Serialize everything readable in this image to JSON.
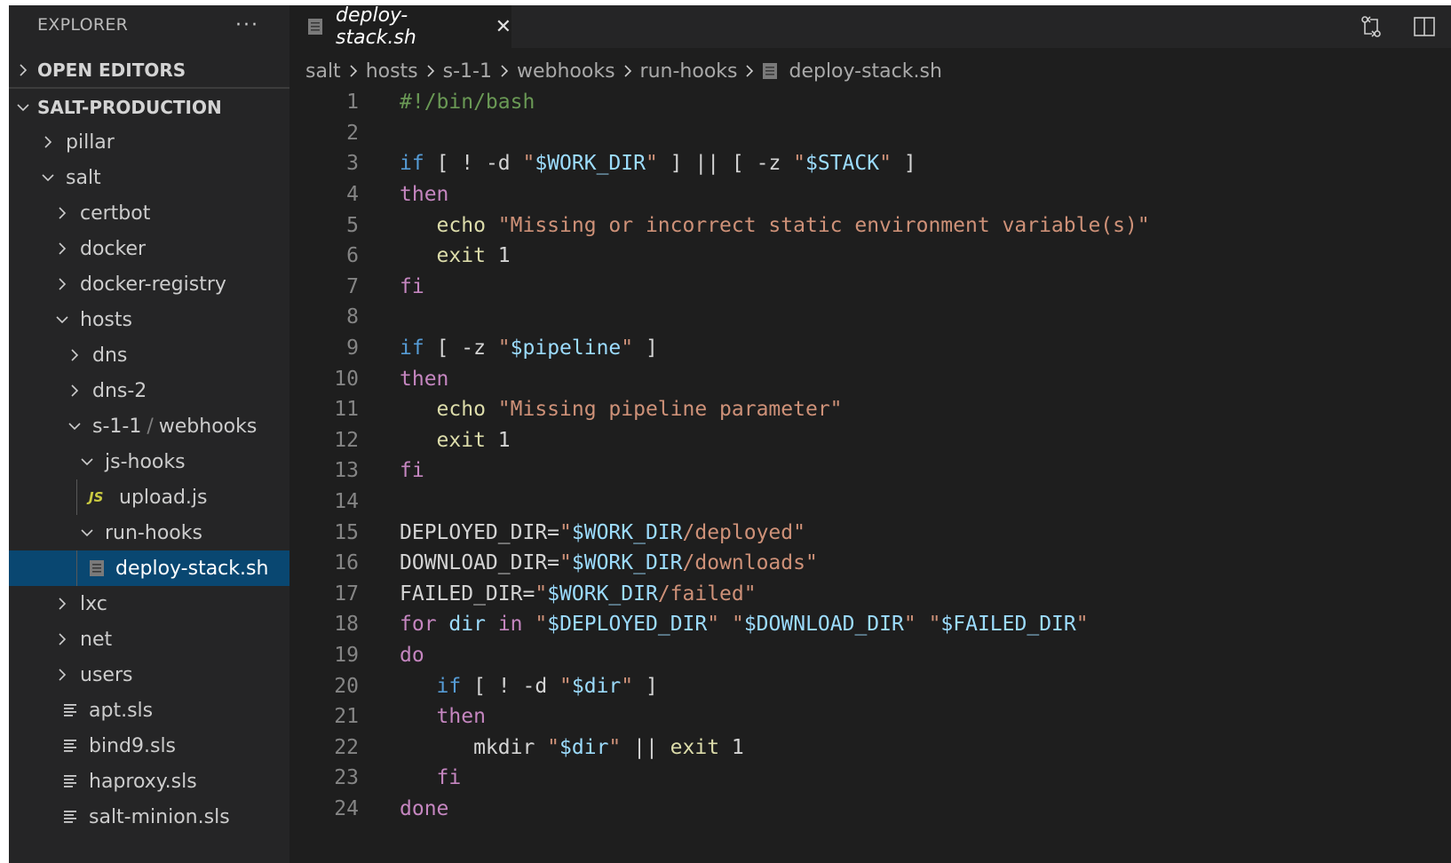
{
  "sidebar": {
    "title": "EXPLORER",
    "more_label": "···",
    "open_editors": "OPEN EDITORS",
    "workspace": "SALT-PRODUCTION",
    "tree": [
      {
        "label": "pillar",
        "level": 0,
        "kind": "folder",
        "expanded": false
      },
      {
        "label": "salt",
        "level": 0,
        "kind": "folder",
        "expanded": true
      },
      {
        "label": "certbot",
        "level": 1,
        "kind": "folder",
        "expanded": false
      },
      {
        "label": "docker",
        "level": 1,
        "kind": "folder",
        "expanded": false
      },
      {
        "label": "docker-registry",
        "level": 1,
        "kind": "folder",
        "expanded": false
      },
      {
        "label": "hosts",
        "level": 1,
        "kind": "folder",
        "expanded": true
      },
      {
        "label": "dns",
        "level": 2,
        "kind": "folder",
        "expanded": false
      },
      {
        "label": "dns-2",
        "level": 2,
        "kind": "folder",
        "expanded": false
      },
      {
        "label": "s-1-1",
        "suffix": "webhooks",
        "separator": "/",
        "level": 2,
        "kind": "folder",
        "expanded": true
      },
      {
        "label": "js-hooks",
        "level": 3,
        "kind": "folder",
        "expanded": true
      },
      {
        "label": "upload.js",
        "level": 4,
        "kind": "js",
        "icon_text": "JS"
      },
      {
        "label": "run-hooks",
        "level": 3,
        "kind": "folder",
        "expanded": true
      },
      {
        "label": "deploy-stack.sh",
        "level": 4,
        "kind": "sh",
        "selected": true
      },
      {
        "label": "lxc",
        "level": 1,
        "kind": "folder",
        "expanded": false
      },
      {
        "label": "net",
        "level": 1,
        "kind": "folder",
        "expanded": false
      },
      {
        "label": "users",
        "level": 1,
        "kind": "folder",
        "expanded": false
      },
      {
        "label": "apt.sls",
        "level": 1,
        "kind": "sls"
      },
      {
        "label": "bind9.sls",
        "level": 1,
        "kind": "sls"
      },
      {
        "label": "haproxy.sls",
        "level": 1,
        "kind": "sls"
      },
      {
        "label": "salt-minion.sls",
        "level": 1,
        "kind": "sls"
      }
    ]
  },
  "editor": {
    "tab": {
      "label": "deploy-stack.sh",
      "close": "✕"
    },
    "breadcrumb": [
      "salt",
      "hosts",
      "s-1-1",
      "webhooks",
      "run-hooks",
      "deploy-stack.sh"
    ],
    "lines": [
      [
        [
          "#!/bin/bash",
          "comment"
        ]
      ],
      [],
      [
        [
          "if",
          "kw"
        ],
        [
          " [ ! -d ",
          "plain"
        ],
        [
          "\"",
          "str"
        ],
        [
          "$WORK_DIR",
          "var"
        ],
        [
          "\"",
          "str"
        ],
        [
          " ] || [ -z ",
          "plain"
        ],
        [
          "\"",
          "str"
        ],
        [
          "$STACK",
          "var"
        ],
        [
          "\"",
          "str"
        ],
        [
          " ]",
          "plain"
        ]
      ],
      [
        [
          "then",
          "ctrl"
        ]
      ],
      [
        [
          "   ",
          "plain"
        ],
        [
          "echo",
          "builtin"
        ],
        [
          " ",
          "plain"
        ],
        [
          "\"Missing or incorrect static environment variable(s)\"",
          "str"
        ]
      ],
      [
        [
          "   ",
          "plain"
        ],
        [
          "exit",
          "builtin"
        ],
        [
          " 1",
          "plain"
        ]
      ],
      [
        [
          "fi",
          "ctrl"
        ]
      ],
      [],
      [
        [
          "if",
          "kw"
        ],
        [
          " [ -z ",
          "plain"
        ],
        [
          "\"",
          "str"
        ],
        [
          "$pipeline",
          "var"
        ],
        [
          "\"",
          "str"
        ],
        [
          " ]",
          "plain"
        ]
      ],
      [
        [
          "then",
          "ctrl"
        ]
      ],
      [
        [
          "   ",
          "plain"
        ],
        [
          "echo",
          "builtin"
        ],
        [
          " ",
          "plain"
        ],
        [
          "\"Missing pipeline parameter\"",
          "str"
        ]
      ],
      [
        [
          "   ",
          "plain"
        ],
        [
          "exit",
          "builtin"
        ],
        [
          " 1",
          "plain"
        ]
      ],
      [
        [
          "fi",
          "ctrl"
        ]
      ],
      [],
      [
        [
          "DEPLOYED_DIR=",
          "plain"
        ],
        [
          "\"",
          "str"
        ],
        [
          "$WORK_DIR",
          "var"
        ],
        [
          "/deployed\"",
          "str"
        ]
      ],
      [
        [
          "DOWNLOAD_DIR=",
          "plain"
        ],
        [
          "\"",
          "str"
        ],
        [
          "$WORK_DIR",
          "var"
        ],
        [
          "/downloads\"",
          "str"
        ]
      ],
      [
        [
          "FAILED_DIR=",
          "plain"
        ],
        [
          "\"",
          "str"
        ],
        [
          "$WORK_DIR",
          "var"
        ],
        [
          "/failed\"",
          "str"
        ]
      ],
      [
        [
          "for",
          "ctrl"
        ],
        [
          " ",
          "plain"
        ],
        [
          "dir",
          "var"
        ],
        [
          " ",
          "plain"
        ],
        [
          "in",
          "ctrl"
        ],
        [
          " ",
          "plain"
        ],
        [
          "\"",
          "str"
        ],
        [
          "$DEPLOYED_DIR",
          "var"
        ],
        [
          "\"",
          "str"
        ],
        [
          " ",
          "plain"
        ],
        [
          "\"",
          "str"
        ],
        [
          "$DOWNLOAD_DIR",
          "var"
        ],
        [
          "\"",
          "str"
        ],
        [
          " ",
          "plain"
        ],
        [
          "\"",
          "str"
        ],
        [
          "$FAILED_DIR",
          "var"
        ],
        [
          "\"",
          "str"
        ]
      ],
      [
        [
          "do",
          "ctrl"
        ]
      ],
      [
        [
          "   ",
          "plain"
        ],
        [
          "if",
          "kw"
        ],
        [
          " [ ! -d ",
          "plain"
        ],
        [
          "\"",
          "str"
        ],
        [
          "$dir",
          "var"
        ],
        [
          "\"",
          "str"
        ],
        [
          " ]",
          "plain"
        ]
      ],
      [
        [
          "   ",
          "plain"
        ],
        [
          "then",
          "ctrl"
        ]
      ],
      [
        [
          "      mkdir ",
          "plain"
        ],
        [
          "\"",
          "str"
        ],
        [
          "$dir",
          "var"
        ],
        [
          "\"",
          "str"
        ],
        [
          " || ",
          "plain"
        ],
        [
          "exit",
          "builtin"
        ],
        [
          " 1",
          "plain"
        ]
      ],
      [
        [
          "   ",
          "plain"
        ],
        [
          "fi",
          "ctrl"
        ]
      ],
      [
        [
          "done",
          "ctrl"
        ]
      ]
    ]
  },
  "colors": {
    "selection": "#094771",
    "sidebar_bg": "#252526",
    "editor_bg": "#1e1e1e"
  }
}
